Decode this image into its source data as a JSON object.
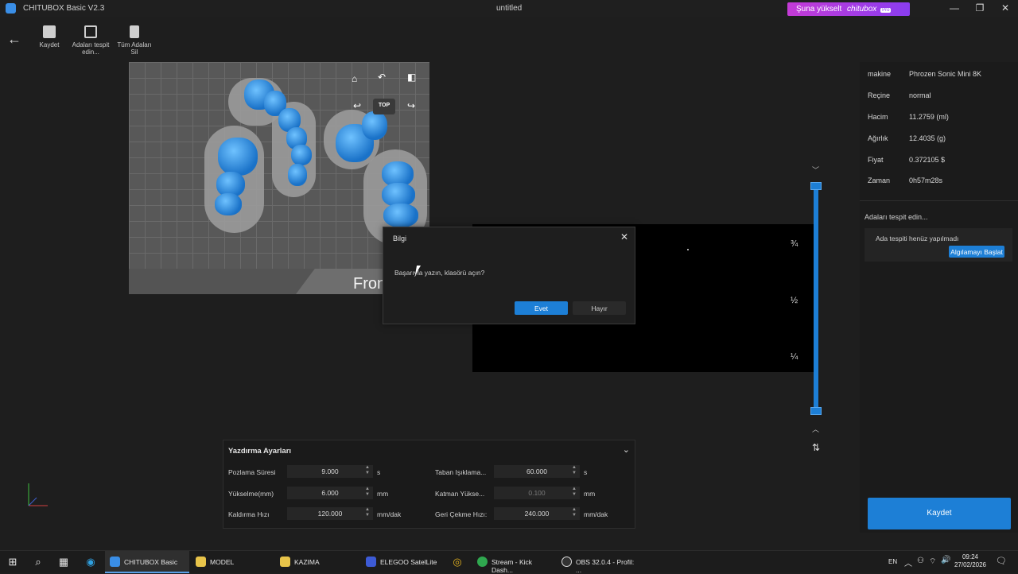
{
  "window": {
    "app_title": "CHITUBOX Basic V2.3",
    "doc_title": "untitled",
    "upgrade_label": "Şuna yükselt",
    "upgrade_brand": "chitubox",
    "upgrade_badge": "Pro"
  },
  "toolbar": {
    "save_label": "Kaydet",
    "detect_label": "Adaları tespit edin...",
    "delete_label": "Tüm Adaları Sil"
  },
  "viewport": {
    "top_label": "TOP",
    "front_label": "Fron"
  },
  "layers": {
    "three_quarter": "¾",
    "half": "½",
    "quarter": "¼"
  },
  "info": {
    "rows": [
      {
        "key": "makine",
        "value": "Phrozen Sonic Mini 8K"
      },
      {
        "key": "Reçine",
        "value": "normal"
      },
      {
        "key": "Hacim",
        "value": "11.2759 (ml)"
      },
      {
        "key": "Ağırlık",
        "value": "12.4035 (g)"
      },
      {
        "key": "Fiyat",
        "value": "0.372105 $"
      },
      {
        "key": "Zaman",
        "value": "0h57m28s"
      }
    ],
    "island_title": "Adaları tespit edin...",
    "island_message": "Ada tespiti henüz yapılmadı",
    "detect_button": "Algılamayı Başlat",
    "save_button": "Kaydet"
  },
  "dialog": {
    "title": "Bilgi",
    "message": "Başarıyla yazın, klasörü açın?",
    "yes": "Evet",
    "no": "Hayır"
  },
  "print_settings": {
    "title": "Yazdırma Ayarları",
    "fields": [
      {
        "label": "Pozlama Süresi",
        "value": "9.000",
        "unit": "s"
      },
      {
        "label": "Yükselme(mm)",
        "value": "6.000",
        "unit": "mm"
      },
      {
        "label": "Kaldırma Hızı",
        "value": "120.000",
        "unit": "mm/dak"
      },
      {
        "label": "Taban Işıklama...",
        "value": "60.000",
        "unit": "s"
      },
      {
        "label": "Katman Yükse...",
        "value": "0.100",
        "unit": "mm"
      },
      {
        "label": "Geri Çekme Hızı:",
        "value": "240.000",
        "unit": "mm/dak"
      }
    ]
  },
  "taskbar": {
    "apps": [
      {
        "label": "CHITUBOX Basic",
        "color": "#3a8ee6"
      },
      {
        "label": "MODEL",
        "color": "#e8c44a"
      },
      {
        "label": "KAZIMA",
        "color": "#e8c44a"
      },
      {
        "label": "ELEGOO SatelLite",
        "color": "#3d5bd6"
      },
      {
        "label": "Stream - Kick Dash...",
        "color": "#2fa84f"
      },
      {
        "label": "OBS 32.0.4 - Profil: ...",
        "color": "#333333"
      }
    ],
    "lang": "EN",
    "time": "09:24",
    "date": "27/02/2026"
  },
  "colors": {
    "accent": "#1d7fd6",
    "upgrade": "#c43bd6"
  }
}
